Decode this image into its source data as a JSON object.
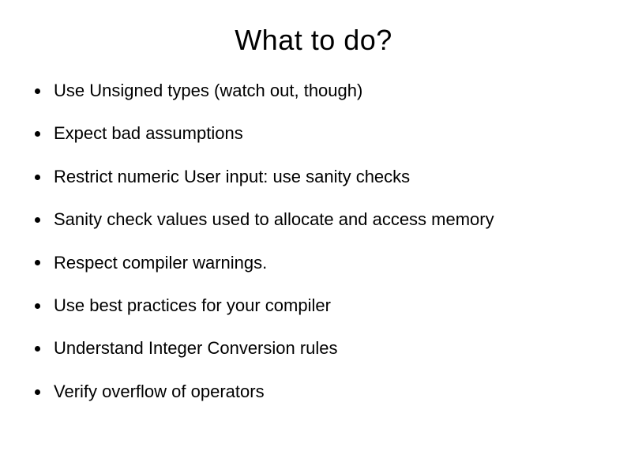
{
  "title": "What to do?",
  "bullets": [
    "Use Unsigned types (watch out, though)",
    "Expect bad assumptions",
    "Restrict numeric User input: use sanity checks",
    "Sanity check values used to allocate and access memory",
    "Respect compiler warnings.",
    "Use best practices for your compiler",
    "Understand Integer Conversion rules",
    "Verify overflow of operators"
  ]
}
